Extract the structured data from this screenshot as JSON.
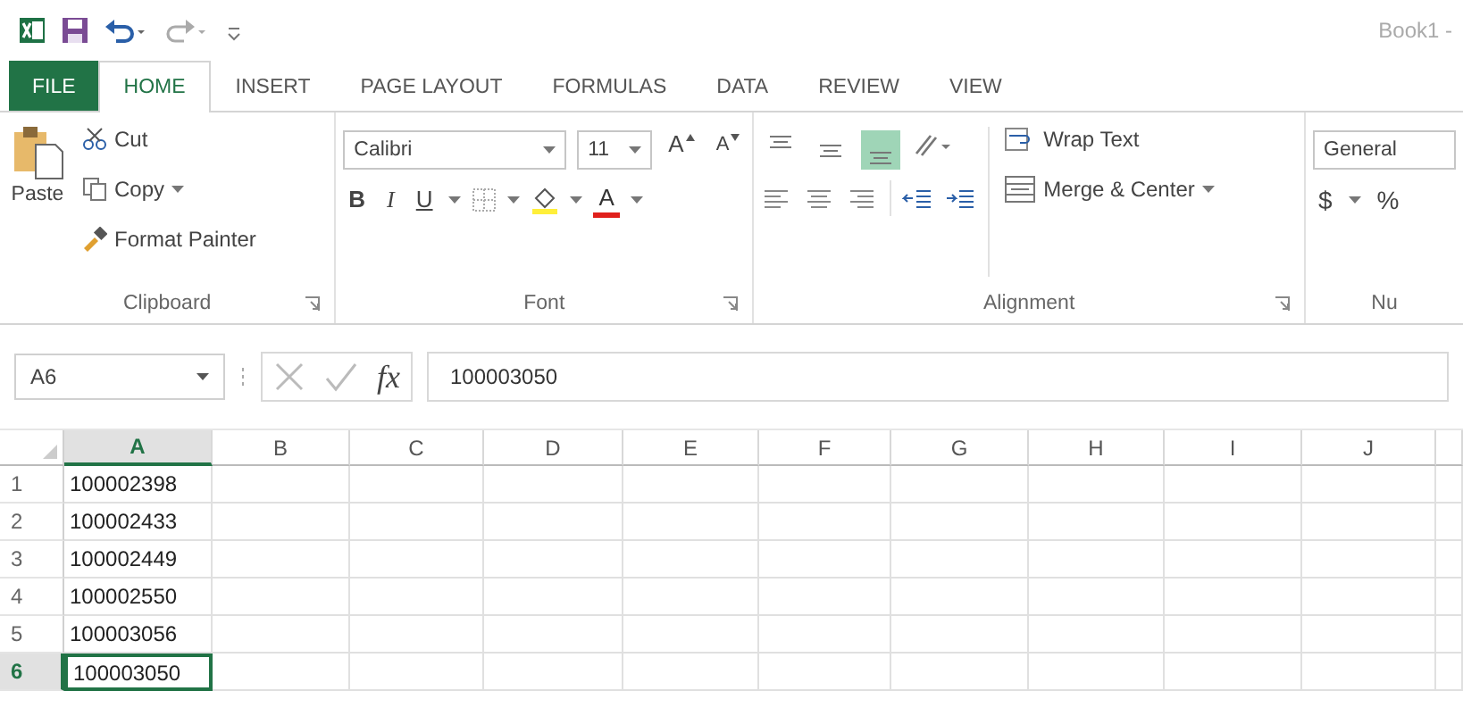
{
  "title_bar": {
    "title": "Book1 -"
  },
  "tabs": [
    {
      "label": "FILE",
      "kind": "file",
      "selected": false
    },
    {
      "label": "HOME",
      "kind": "tab",
      "selected": true
    },
    {
      "label": "INSERT",
      "kind": "tab",
      "selected": false
    },
    {
      "label": "PAGE LAYOUT",
      "kind": "tab",
      "selected": false
    },
    {
      "label": "FORMULAS",
      "kind": "tab",
      "selected": false
    },
    {
      "label": "DATA",
      "kind": "tab",
      "selected": false
    },
    {
      "label": "REVIEW",
      "kind": "tab",
      "selected": false
    },
    {
      "label": "VIEW",
      "kind": "tab",
      "selected": false
    }
  ],
  "clipboard": {
    "paste": "Paste",
    "cut": "Cut",
    "copy": "Copy",
    "format_painter": "Format Painter",
    "label": "Clipboard"
  },
  "font": {
    "name": "Calibri",
    "size": "11",
    "grow": "A",
    "shrink": "A",
    "bold": "B",
    "italic": "I",
    "underline": "U",
    "font_color": "A",
    "label": "Font"
  },
  "alignment": {
    "vertical": [
      {
        "kind": "top",
        "selected": false
      },
      {
        "kind": "middle",
        "selected": false
      },
      {
        "kind": "bottom",
        "selected": true
      }
    ],
    "wrap_text": "Wrap Text",
    "merge": "Merge & Center",
    "label": "Alignment"
  },
  "number": {
    "format": "General",
    "currency": "$",
    "percent": "%",
    "label": "Nu"
  },
  "formula_bar": {
    "name_box": "A6",
    "fx": "fx",
    "value": "100003050"
  },
  "grid": {
    "columns": [
      {
        "label": "A",
        "selected": true
      },
      {
        "label": "B",
        "selected": false
      },
      {
        "label": "C",
        "selected": false
      },
      {
        "label": "D",
        "selected": false
      },
      {
        "label": "E",
        "selected": false
      },
      {
        "label": "F",
        "selected": false
      },
      {
        "label": "G",
        "selected": false
      },
      {
        "label": "H",
        "selected": false
      },
      {
        "label": "I",
        "selected": false
      },
      {
        "label": "J",
        "selected": false
      }
    ],
    "rows": [
      {
        "label": "1",
        "value": "100002398",
        "selected": false
      },
      {
        "label": "2",
        "value": "100002433",
        "selected": false
      },
      {
        "label": "3",
        "value": "100002449",
        "selected": false
      },
      {
        "label": "4",
        "value": "100002550",
        "selected": false
      },
      {
        "label": "5",
        "value": "100003056",
        "selected": false
      },
      {
        "label": "6",
        "value": "100003050",
        "selected": true
      }
    ]
  }
}
